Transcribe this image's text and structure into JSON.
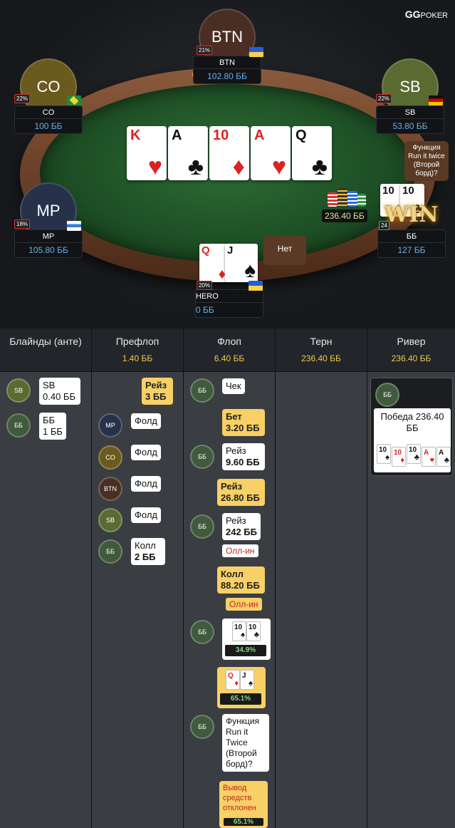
{
  "logo": {
    "gg": "GG",
    "poker": "POKER"
  },
  "seats": {
    "btn": {
      "avatar": "BTN",
      "name": "BTN",
      "stack": "102.80 ББ",
      "pct": "21%"
    },
    "co": {
      "avatar": "CO",
      "name": "CO",
      "stack": "100 ББ",
      "pct": "22%"
    },
    "sb": {
      "avatar": "SB",
      "name": "SB",
      "stack": "53.80 ББ",
      "pct": "22%"
    },
    "mp": {
      "avatar": "MP",
      "name": "MP",
      "stack": "105.80 ББ",
      "pct": "18%"
    },
    "bb": {
      "name": "ББ",
      "stack": "127 ББ",
      "win": "WIN",
      "pct": "24"
    },
    "hero": {
      "name": "HERO",
      "stack": "0 ББ",
      "pct": "20%"
    }
  },
  "dealer_button": "D",
  "board": [
    {
      "rank": "K",
      "suit": "♥",
      "color": "red"
    },
    {
      "rank": "A",
      "suit": "♣",
      "color": "black"
    },
    {
      "rank": "10",
      "suit": "♦",
      "color": "red"
    },
    {
      "rank": "A",
      "suit": "♥",
      "color": "red"
    },
    {
      "rank": "Q",
      "suit": "♣",
      "color": "black"
    }
  ],
  "hero_cards": [
    {
      "rank": "Q",
      "suit": "♦",
      "color": "red"
    },
    {
      "rank": "J",
      "suit": "♠",
      "color": "black"
    }
  ],
  "bb_cards": [
    {
      "rank": "10",
      "suit": "♠",
      "color": "black"
    },
    {
      "rank": "10",
      "suit": "♣",
      "color": "black"
    }
  ],
  "pot_label": "236.40 ББ",
  "hero_bubble": "Нет",
  "rit_bubble": "Функция Run it twice (Второй борд)?",
  "history": {
    "cols": [
      {
        "title": "Блайнды (анте)",
        "pot": ""
      },
      {
        "title": "Префлоп",
        "pot": "1.40 ББ"
      },
      {
        "title": "Флоп",
        "pot": "6.40 ББ"
      },
      {
        "title": "Терн",
        "pot": "236.40 ББ"
      },
      {
        "title": "Ривер",
        "pot": "236.40 ББ"
      }
    ],
    "blinds": {
      "sb_chip": "SB",
      "sb_text": "SB",
      "sb_amt": "0.40 ББ",
      "bb_chip": "ББ",
      "bb_text": "ББ",
      "bb_amt": "1 ББ"
    },
    "preflop": {
      "raise": "Рейз",
      "raise_amt": "3 ББ",
      "mp_chip": "MP",
      "co_chip": "CO",
      "btn_chip": "BTN",
      "sb_chip": "SB",
      "bb_chip": "ББ",
      "fold": "Фолд",
      "call": "Колл",
      "call_amt": "2 ББ"
    },
    "flop": {
      "bb_chip": "ББ",
      "check": "Чек",
      "bet": "Бет",
      "bet_amt": "3.20 ББ",
      "raise1": "Рейз",
      "raise1_amt": "9.60 ББ",
      "raise2": "Рейз",
      "raise2_amt": "26.80 ББ",
      "raise3": "Рейз",
      "raise3_amt": "242 ББ",
      "allin": "Олл-ин",
      "call": "Колл",
      "call_amt": "88.20 ББ",
      "allin2": "Олл-ин",
      "eq_bb": "34.9%",
      "eq_hero": "65.1%",
      "rit_q": "Функция Run it Twice (Второй борд)?",
      "cashout": "Вывод средств отклонен",
      "eq_hero2": "65.1%"
    },
    "river": {
      "bb_chip": "ББ",
      "win_text": "Победа 236.40 ББ",
      "cards": [
        {
          "rank": "10",
          "suit": "♠",
          "color": "black"
        },
        {
          "rank": "10",
          "suit": "♦",
          "color": "red"
        },
        {
          "rank": "10",
          "suit": "♣",
          "color": "black"
        },
        {
          "rank": "A",
          "suit": "♥",
          "color": "red"
        },
        {
          "rank": "A",
          "suit": "♣",
          "color": "black"
        }
      ]
    }
  },
  "colors": {
    "felt": "#1d4d24",
    "accent_yellow": "#f7d066",
    "stack_blue": "#6ab0e8"
  }
}
